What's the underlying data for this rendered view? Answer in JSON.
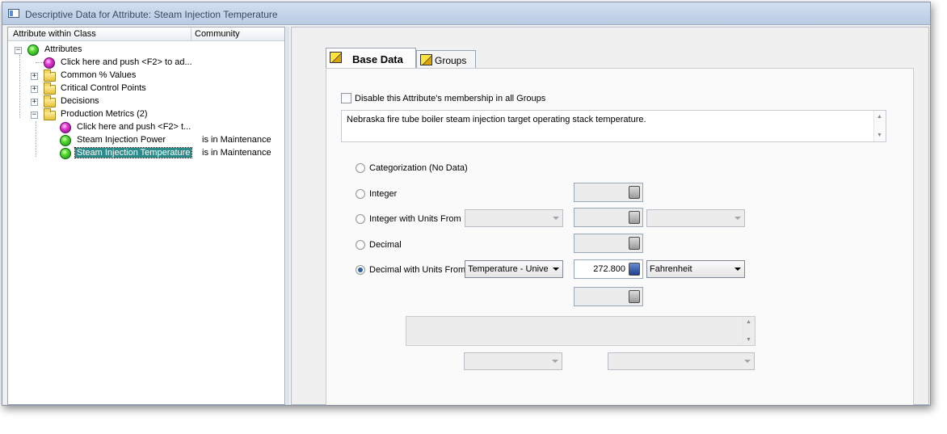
{
  "window": {
    "title": "Descriptive Data for Attribute: Steam Injection Temperature"
  },
  "tree": {
    "columns": {
      "attribute": "Attribute within Class",
      "community": "Community"
    },
    "root": "Attributes",
    "items": [
      {
        "label": "Click here and push <F2> to ad...",
        "icon": "magenta-ball-icon"
      },
      {
        "label": "Common % Values",
        "icon": "folder-icon",
        "expander": "+"
      },
      {
        "label": "Critical Control Points",
        "icon": "folder-icon",
        "expander": "+"
      },
      {
        "label": "Decisions",
        "icon": "folder-icon",
        "expander": "+"
      },
      {
        "label": "Production Metrics (2)",
        "icon": "folder-open-icon",
        "expander": "-"
      }
    ],
    "children": [
      {
        "label": "Click here and push <F2> t...",
        "community": "",
        "icon": "magenta-ball-icon"
      },
      {
        "label": "Steam Injection Power",
        "community": "is in Maintenance",
        "icon": "green-ball-icon"
      },
      {
        "label": "Steam Injection Temperature",
        "community": "is in Maintenance",
        "icon": "green-ball-icon",
        "selected": true
      }
    ]
  },
  "tabs": [
    {
      "label": "Base Data",
      "active": true
    },
    {
      "label": "Groups",
      "active": false
    }
  ],
  "form": {
    "disable_label": "Disable this Attribute's membership in all Groups",
    "description": "Nebraska fire tube boiler steam injection target operating stack temperature.",
    "radios": [
      {
        "label": "Categorization (No Data)",
        "checked": false
      },
      {
        "label": "Integer",
        "checked": false
      },
      {
        "label": "Integer with Units From",
        "checked": false
      },
      {
        "label": "Decimal",
        "checked": false
      },
      {
        "label": "Decimal with Units From",
        "checked": true
      }
    ],
    "units_from_value": "Temperature - Unive",
    "decimal_value": "272.800",
    "unit_value": "Fahrenheit"
  },
  "colors": {
    "selection": "#2d8a8a",
    "titlebar": "#c5d5ea"
  }
}
